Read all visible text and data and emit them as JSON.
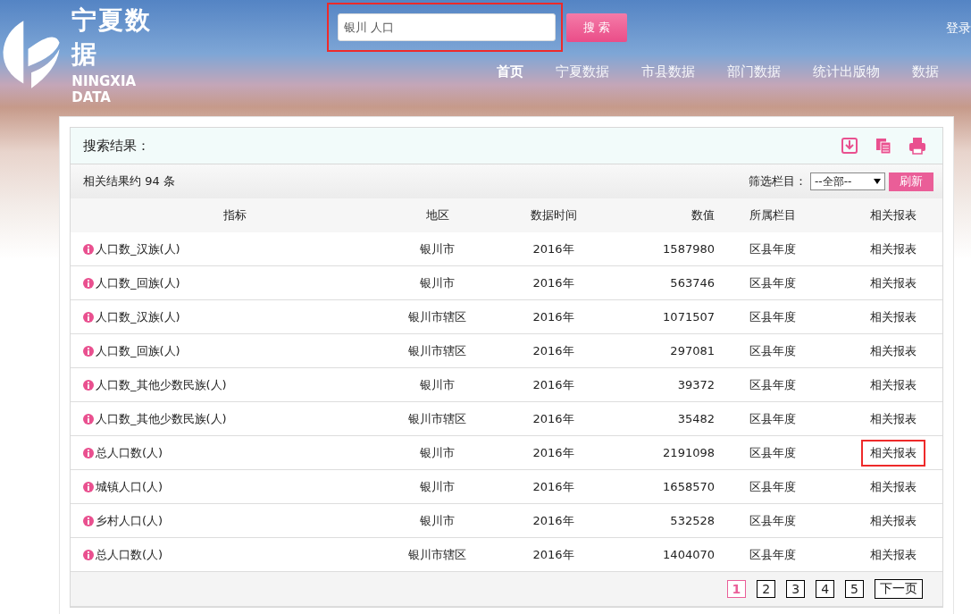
{
  "header": {
    "logo_title": "宁夏数据",
    "logo_subtitle": "NINGXIA DATA",
    "login": "登录",
    "search": {
      "value": "银川 人口",
      "button": "搜 索",
      "highlighted": true
    },
    "nav": [
      {
        "label": "首页",
        "selected": true
      },
      {
        "label": "宁夏数据",
        "selected": false
      },
      {
        "label": "市县数据",
        "selected": false
      },
      {
        "label": "部门数据",
        "selected": false
      },
      {
        "label": "统计出版物",
        "selected": false
      },
      {
        "label": "数据",
        "selected": false
      }
    ]
  },
  "results": {
    "title": "搜索结果：",
    "summary": "相关结果约 94 条",
    "filter_label": "筛选栏目：",
    "filter_value": "--全部--",
    "refresh": "刷新",
    "columns": [
      "指标",
      "地区",
      "数据时间",
      "数值",
      "所属栏目",
      "相关报表"
    ],
    "rows": [
      {
        "indicator": "人口数_汉族(人)",
        "region": "银川市",
        "time": "2016年",
        "value": "1587980",
        "category": "区县年度",
        "link": "相关报表",
        "highlighted": false
      },
      {
        "indicator": "人口数_回族(人)",
        "region": "银川市",
        "time": "2016年",
        "value": "563746",
        "category": "区县年度",
        "link": "相关报表",
        "highlighted": false
      },
      {
        "indicator": "人口数_汉族(人)",
        "region": "银川市辖区",
        "time": "2016年",
        "value": "1071507",
        "category": "区县年度",
        "link": "相关报表",
        "highlighted": false
      },
      {
        "indicator": "人口数_回族(人)",
        "region": "银川市辖区",
        "time": "2016年",
        "value": "297081",
        "category": "区县年度",
        "link": "相关报表",
        "highlighted": false
      },
      {
        "indicator": "人口数_其他少数民族(人)",
        "region": "银川市",
        "time": "2016年",
        "value": "39372",
        "category": "区县年度",
        "link": "相关报表",
        "highlighted": false
      },
      {
        "indicator": "人口数_其他少数民族(人)",
        "region": "银川市辖区",
        "time": "2016年",
        "value": "35482",
        "category": "区县年度",
        "link": "相关报表",
        "highlighted": false
      },
      {
        "indicator": "总人口数(人)",
        "region": "银川市",
        "time": "2016年",
        "value": "2191098",
        "category": "区县年度",
        "link": "相关报表",
        "highlighted": true
      },
      {
        "indicator": "城镇人口(人)",
        "region": "银川市",
        "time": "2016年",
        "value": "1658570",
        "category": "区县年度",
        "link": "相关报表",
        "highlighted": false
      },
      {
        "indicator": "乡村人口(人)",
        "region": "银川市",
        "time": "2016年",
        "value": "532528",
        "category": "区县年度",
        "link": "相关报表",
        "highlighted": false
      },
      {
        "indicator": "总人口数(人)",
        "region": "银川市辖区",
        "time": "2016年",
        "value": "1404070",
        "category": "区县年度",
        "link": "相关报表",
        "highlighted": false
      }
    ],
    "pages": [
      {
        "label": "1",
        "selected": true
      },
      {
        "label": "2",
        "selected": false
      },
      {
        "label": "3",
        "selected": false
      },
      {
        "label": "4",
        "selected": false
      },
      {
        "label": "5",
        "selected": false
      }
    ],
    "next": "下一页"
  }
}
